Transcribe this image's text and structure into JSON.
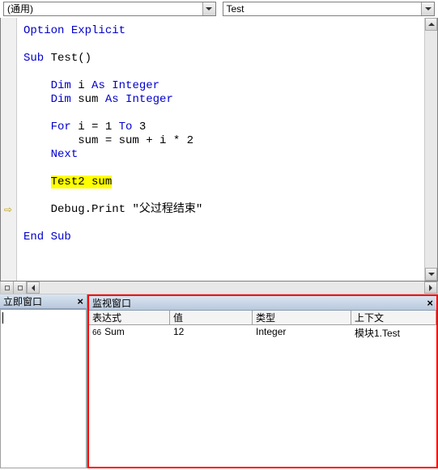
{
  "dropdowns": {
    "object_selector": "(通用)",
    "procedure_selector": "Test"
  },
  "code": {
    "line1_a": "Option",
    "line1_b": " Explicit",
    "line3_a": "Sub",
    "line3_b": " Test()",
    "line5_a": "Dim",
    "line5_b": " i ",
    "line5_c": "As Integer",
    "line6_a": "Dim",
    "line6_b": " sum ",
    "line6_c": "As Integer",
    "line8_a": "For",
    "line8_b": " i = 1 ",
    "line8_c": "To",
    "line8_d": " 3",
    "line9": "sum = sum + i * 2",
    "line10": "Next",
    "line12": "Test2 sum",
    "line14_a": "Debug.Print ",
    "line14_b": "\"父过程结束\"",
    "line16_a": "End",
    "line16_b": " ",
    "line16_c": "Sub"
  },
  "execution": {
    "current_line_index": 13
  },
  "immediate_window": {
    "title": "立即窗口",
    "content": ""
  },
  "watch_window": {
    "title": "监视窗口",
    "columns": {
      "expression": "表达式",
      "value": "值",
      "type": "类型",
      "context": "上下文"
    },
    "rows": [
      {
        "icon": "66",
        "expression": "Sum",
        "value": "12",
        "type": "Integer",
        "context": "模块1.Test"
      }
    ]
  }
}
